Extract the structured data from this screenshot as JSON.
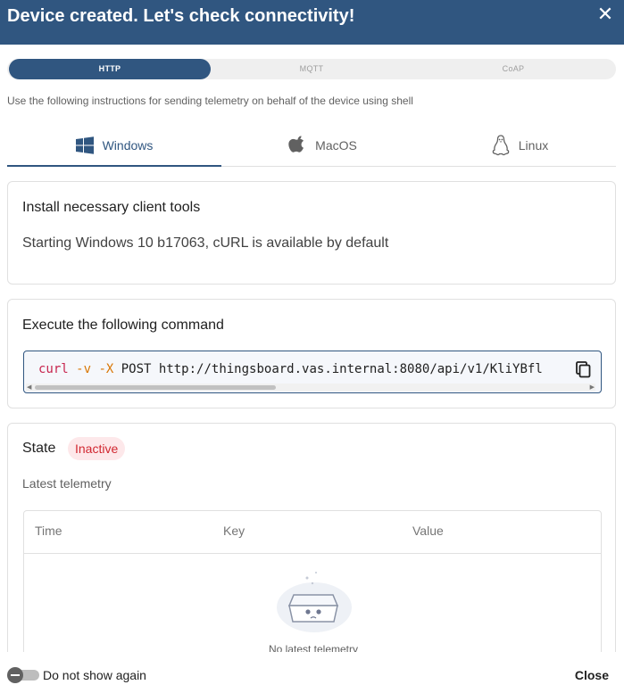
{
  "dialog": {
    "title": "Device created. Let's check connectivity!",
    "close_icon": "close-icon"
  },
  "protocols": {
    "options": [
      "HTTP",
      "MQTT",
      "CoAP"
    ],
    "selected": "HTTP"
  },
  "hint": "Use the following instructions for sending telemetry on behalf of the device using shell",
  "os_tabs": {
    "items": [
      {
        "label": "Windows",
        "icon": "windows-icon"
      },
      {
        "label": "MacOS",
        "icon": "apple-icon"
      },
      {
        "label": "Linux",
        "icon": "linux-icon"
      }
    ],
    "selected": "Windows"
  },
  "install": {
    "title": "Install necessary client tools",
    "text": "Starting Windows 10 b17063, cURL is available by default"
  },
  "execute": {
    "title": "Execute the following command",
    "cmd_curl": "curl",
    "cmd_v": "-v",
    "cmd_x": "-X",
    "cmd_rest": "POST http://thingsboard.vas.internal:8080/api/v1/KliYBfl",
    "copy_icon": "copy-icon"
  },
  "state": {
    "label": "State",
    "badge": "Inactive",
    "badge_color": "#d12730",
    "subtitle": "Latest telemetry",
    "columns": [
      "Time",
      "Key",
      "Value"
    ],
    "empty_text": "No latest telemetry"
  },
  "footer": {
    "dont_show": "Do not show again",
    "close": "Close"
  },
  "colors": {
    "primary": "#305680",
    "inactive_bg": "#fde8ea"
  }
}
